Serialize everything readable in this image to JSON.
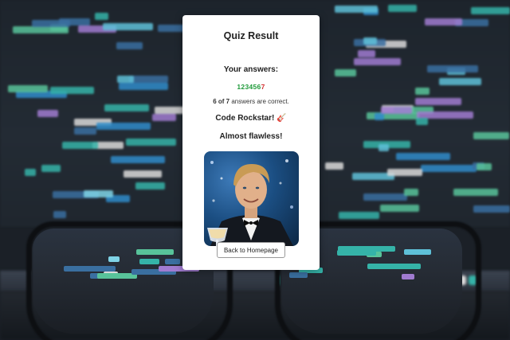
{
  "quiz": {
    "title": "Quiz Result",
    "answers_label": "Your answers:",
    "answers": [
      {
        "number": "1",
        "status": "correct"
      },
      {
        "number": "2",
        "status": "correct"
      },
      {
        "number": "3",
        "status": "correct"
      },
      {
        "number": "4",
        "status": "correct"
      },
      {
        "number": "5",
        "status": "correct"
      },
      {
        "number": "6",
        "status": "correct"
      },
      {
        "number": "7",
        "status": "wrong"
      }
    ],
    "score_value": "6 of 7",
    "score_suffix": " answers are correct.",
    "rank_label": "Code Rockstar! 🎸",
    "comment": "Almost flawless!",
    "image_icon": "celebration-photo-icon",
    "home_button_label": "Back to Homepage"
  },
  "colors": {
    "correct": "#1f9a3a",
    "wrong": "#d23434",
    "card_bg": "#ffffff"
  }
}
